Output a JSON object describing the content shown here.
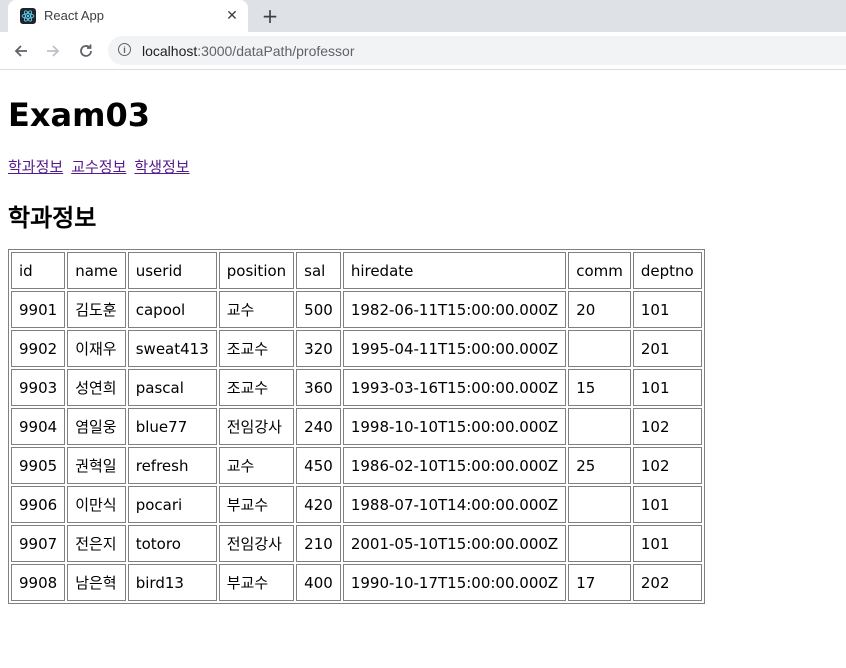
{
  "browser": {
    "tab_title": "React App",
    "url_host": "localhost",
    "url_rest": ":3000/dataPath/professor",
    "colors": {
      "react_logo": "#61dafb",
      "link_visited": "#551a8b"
    }
  },
  "page": {
    "title": "Exam03",
    "links": [
      "학과정보",
      "교수정보",
      "학생정보"
    ],
    "section_title": "학과정보"
  },
  "table": {
    "headers": [
      "id",
      "name",
      "userid",
      "position",
      "sal",
      "hiredate",
      "comm",
      "deptno"
    ],
    "rows": [
      [
        "9901",
        "김도훈",
        "capool",
        "교수",
        "500",
        "1982-06-11T15:00:00.000Z",
        "20",
        "101"
      ],
      [
        "9902",
        "이재우",
        "sweat413",
        "조교수",
        "320",
        "1995-04-11T15:00:00.000Z",
        "",
        "201"
      ],
      [
        "9903",
        "성연희",
        "pascal",
        "조교수",
        "360",
        "1993-03-16T15:00:00.000Z",
        "15",
        "101"
      ],
      [
        "9904",
        "염일웅",
        "blue77",
        "전임강사",
        "240",
        "1998-10-10T15:00:00.000Z",
        "",
        "102"
      ],
      [
        "9905",
        "권혁일",
        "refresh",
        "교수",
        "450",
        "1986-02-10T15:00:00.000Z",
        "25",
        "102"
      ],
      [
        "9906",
        "이만식",
        "pocari",
        "부교수",
        "420",
        "1988-07-10T14:00:00.000Z",
        "",
        "101"
      ],
      [
        "9907",
        "전은지",
        "totoro",
        "전임강사",
        "210",
        "2001-05-10T15:00:00.000Z",
        "",
        "101"
      ],
      [
        "9908",
        "남은혁",
        "bird13",
        "부교수",
        "400",
        "1990-10-17T15:00:00.000Z",
        "17",
        "202"
      ]
    ]
  }
}
